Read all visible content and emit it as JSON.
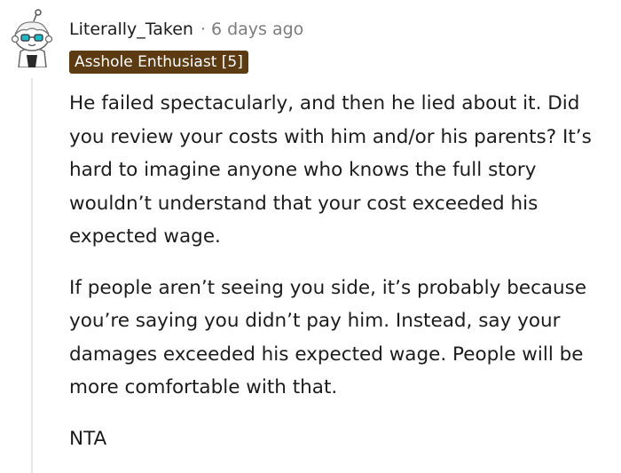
{
  "comment": {
    "author": "Literally_Taken",
    "separator": "·",
    "timestamp": "6 days ago",
    "flair": "Asshole Enthusiast [5]",
    "paragraphs": [
      "He failed spectacularly, and then he lied about it. Did you review your costs with him and/or his parents? It’s hard to imagine anyone who knows the full story wouldn’t understand that your cost exceeded his expected wage.",
      "If people aren’t seeing you side, it’s probably because you’re saying you didn’t pay him. Instead, say your damages exceeded his expected wage. People will be more comfortable with that.",
      "NTA"
    ],
    "avatar_icon": "snoo-avatar-icon"
  },
  "colors": {
    "flair_bg": "#5c3a12",
    "flair_text": "#ffffff",
    "meta_text": "#7c7c7c",
    "body_text": "#1c1c1c",
    "thread_line": "#e5e7ea"
  }
}
